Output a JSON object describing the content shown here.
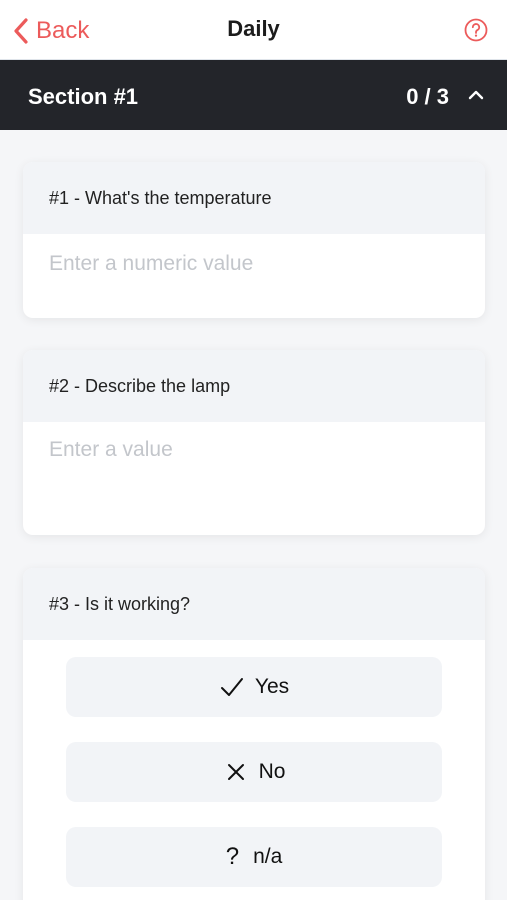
{
  "nav": {
    "back_label": "Back",
    "title": "Daily",
    "accent_color": "#ec5b5b"
  },
  "section": {
    "title": "Section #1",
    "progress": "0 / 3"
  },
  "questions": [
    {
      "label": "#1 - What's the temperature",
      "placeholder": "Enter a numeric value"
    },
    {
      "label": "#2 - Describe the lamp",
      "placeholder": "Enter a value"
    },
    {
      "label": "#3 - Is it working?",
      "options": [
        {
          "icon": "check-icon",
          "label": "Yes"
        },
        {
          "icon": "cross-icon",
          "label": "No"
        },
        {
          "icon": "question-mark",
          "symbol": "?",
          "label": "n/a"
        }
      ]
    }
  ]
}
